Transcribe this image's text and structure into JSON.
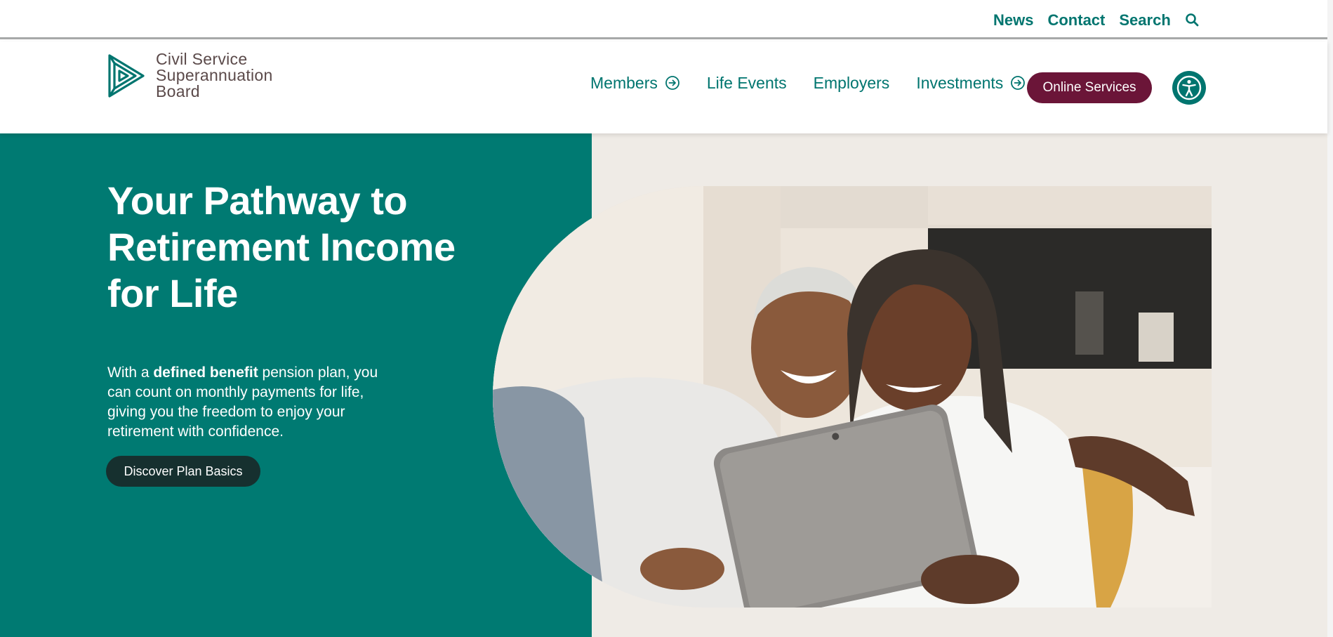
{
  "utility": {
    "links": [
      "News",
      "Contact",
      "Search"
    ],
    "search_icon": "search-icon"
  },
  "header": {
    "logo": {
      "lines": [
        "Civil Service",
        "Superannuation",
        "Board"
      ],
      "icon": "triangle-logo-icon"
    },
    "nav": [
      {
        "label": "Members",
        "has_arrow": true
      },
      {
        "label": "Life Events",
        "has_arrow": false
      },
      {
        "label": "Employers",
        "has_arrow": false
      },
      {
        "label": "Investments",
        "has_arrow": true
      }
    ],
    "online_services_label": "Online Services",
    "accessibility_icon": "accessibility-icon"
  },
  "hero": {
    "title": "Your Pathway to Retirement Income for Life",
    "body_prefix": "With a ",
    "body_bold": "defined benefit",
    "body_suffix": " pension plan, you can count on monthly payments for life, giving you the freedom to enjoy your retirement with confidence.",
    "cta_label": "Discover Plan Basics",
    "image_alt_icon": "couple-with-tablet-photo"
  },
  "colors": {
    "brand_teal": "#00756f",
    "hero_teal": "#007a72",
    "online_services_bg": "#6b1538",
    "cta_bg": "#16302f",
    "hero_right_bg": "#efebe6"
  }
}
